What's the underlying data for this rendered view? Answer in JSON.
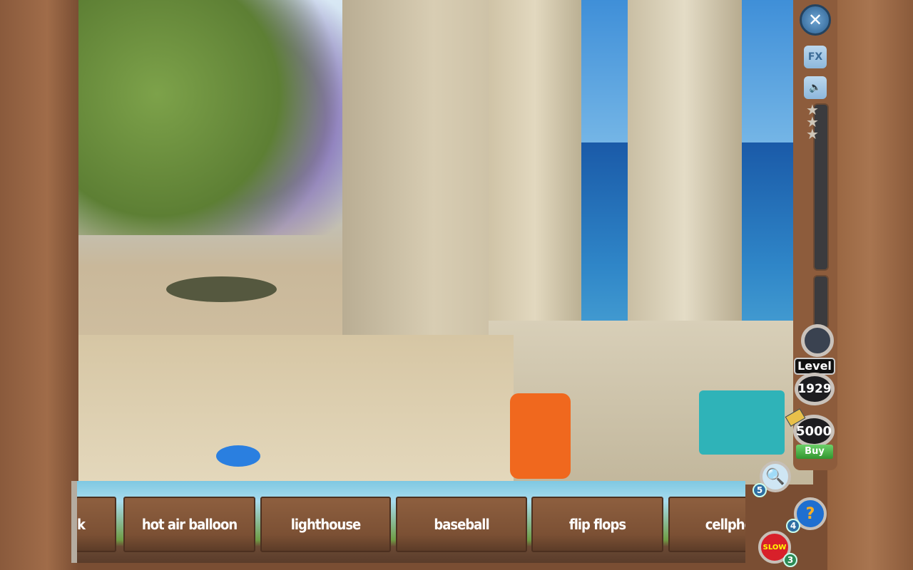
{
  "game": {
    "scene": "terrace by the sea"
  },
  "controls": {
    "close_icon": "close-icon",
    "fx_label": "FX",
    "sound_icon": "speaker-icon"
  },
  "progress": {
    "stars_total": 3,
    "stars_earned": 0,
    "fill": 0
  },
  "level": {
    "label": "Level",
    "value": "1929"
  },
  "currency": {
    "value": "5000",
    "buy_label": "Buy"
  },
  "item_list": [
    "k",
    "hot air balloon",
    "lighthouse",
    "baseball",
    "flip flops",
    "cellpho"
  ],
  "hints": {
    "magnifier": {
      "icon": "magnifier-icon",
      "count": "5"
    },
    "question": {
      "icon": "question-icon",
      "count": "4"
    },
    "slow": {
      "label": "SLOW",
      "count": "3"
    }
  }
}
